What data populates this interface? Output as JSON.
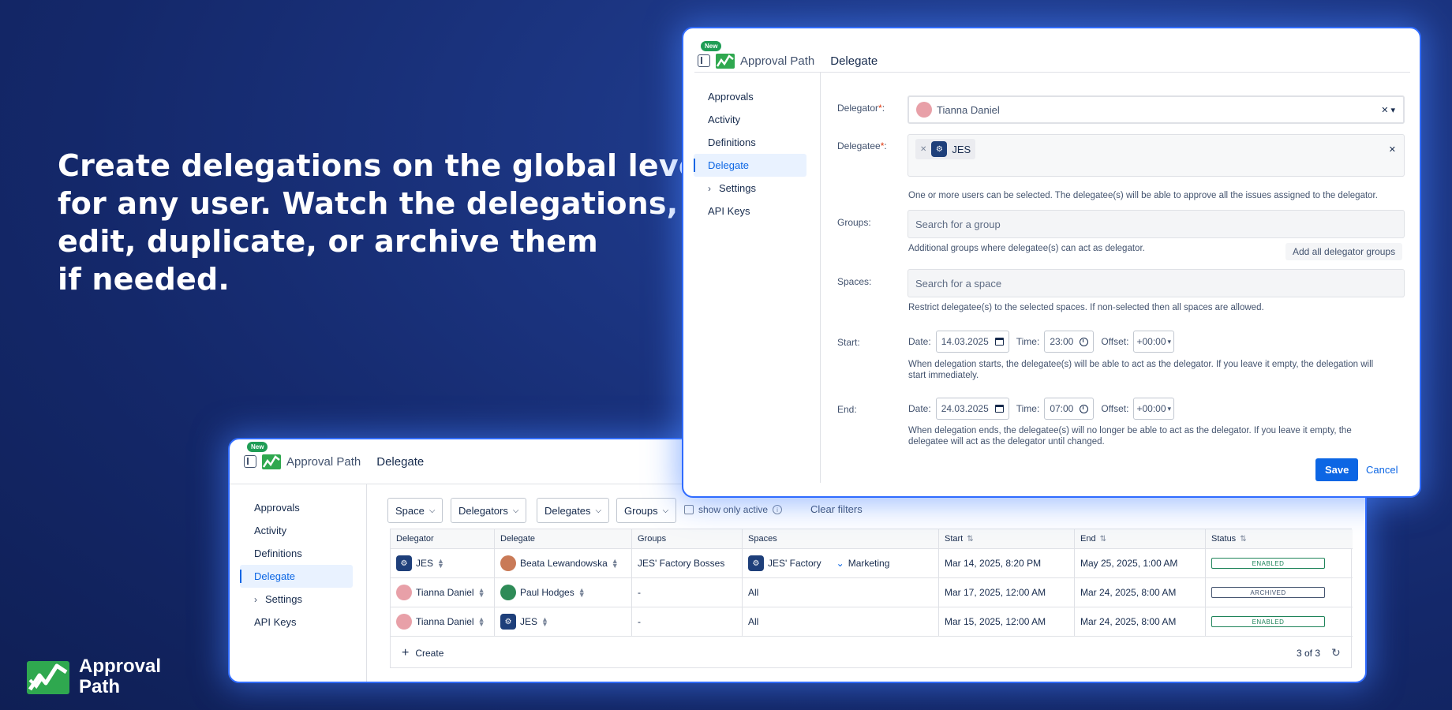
{
  "headline": {
    "line1": "Create delegations on the global level",
    "line2": "for any user. Watch the delegations,",
    "line3": "edit, duplicate, or archive them",
    "line4": "if needed."
  },
  "brand": {
    "line1": "Approval",
    "line2": "Path"
  },
  "app": {
    "name": "Approval Path",
    "section": "Delegate",
    "badge": "New"
  },
  "nav": [
    "Approvals",
    "Activity",
    "Definitions",
    "Delegate",
    "Settings",
    "API Keys"
  ],
  "form": {
    "delegator_label": "Delegator",
    "delegator_value": "Tianna Daniel",
    "delegatee_label": "Delegatee",
    "delegatee_chip": "JES",
    "delegatee_help": "One or more users can be selected. The delegatee(s) will be able to approve all the issues assigned to the delegator.",
    "groups_label": "Groups:",
    "groups_placeholder": "Search for a group",
    "groups_help": "Additional groups where delegatee(s) can act as delegator.",
    "add_groups_button": "Add all delegator groups",
    "spaces_label": "Spaces:",
    "spaces_placeholder": "Search for a space",
    "spaces_help": "Restrict delegatee(s) to the selected spaces. If non-selected then all spaces are allowed.",
    "start_label": "Start:",
    "end_label": "End:",
    "date_label": "Date:",
    "time_label": "Time:",
    "offset_label": "Offset:",
    "start_date": "14.03.2025",
    "start_time": "23:00",
    "start_offset": "+00:00",
    "start_help_1": "When delegation starts, the delegatee(s) will be able to act as the delegator. If you leave it empty, the delegation will",
    "start_help_2": "start immediately.",
    "end_date": "24.03.2025",
    "end_time": "07:00",
    "end_offset": "+00:00",
    "end_help_1": "When delegation ends, the delegatee(s) will no longer be able to act as the delegator. If you leave it empty, the",
    "end_help_2": "delegatee will act as the delegator until changed.",
    "save": "Save",
    "cancel": "Cancel"
  },
  "filters": {
    "space": "Space",
    "delegators": "Delegators",
    "delegates": "Delegates",
    "groups": "Groups",
    "show_only_active": "show only active",
    "clear": "Clear filters"
  },
  "table": {
    "headers": [
      "Delegator",
      "Delegate",
      "Groups",
      "Spaces",
      "Start",
      "End",
      "Status"
    ],
    "rows": [
      {
        "delegator": "JES",
        "delegate": "Beata Lewandowska",
        "groups": "JES' Factory Bosses",
        "space1": "JES' Factory",
        "space2": "Marketing",
        "start": "Mar 14, 2025, 8:20 PM",
        "end": "May 25, 2025, 1:00 AM",
        "status": "ENABLED"
      },
      {
        "delegator": "Tianna Daniel",
        "delegate": "Paul Hodges",
        "groups": "-",
        "space1": "All",
        "space2": "",
        "start": "Mar 17, 2025, 12:00 AM",
        "end": "Mar 24, 2025, 8:00 AM",
        "status": "ARCHIVED"
      },
      {
        "delegator": "Tianna Daniel",
        "delegate": "JES",
        "groups": "-",
        "space1": "All",
        "space2": "",
        "start": "Mar 15, 2025, 12:00 AM",
        "end": "Mar 24, 2025, 8:00 AM",
        "status": "ENABLED"
      }
    ],
    "create": "Create",
    "count": "3 of 3"
  },
  "colors": {
    "accent": "#0c66e4",
    "enabled": "#1f845a",
    "glow": "#2f6bff"
  }
}
